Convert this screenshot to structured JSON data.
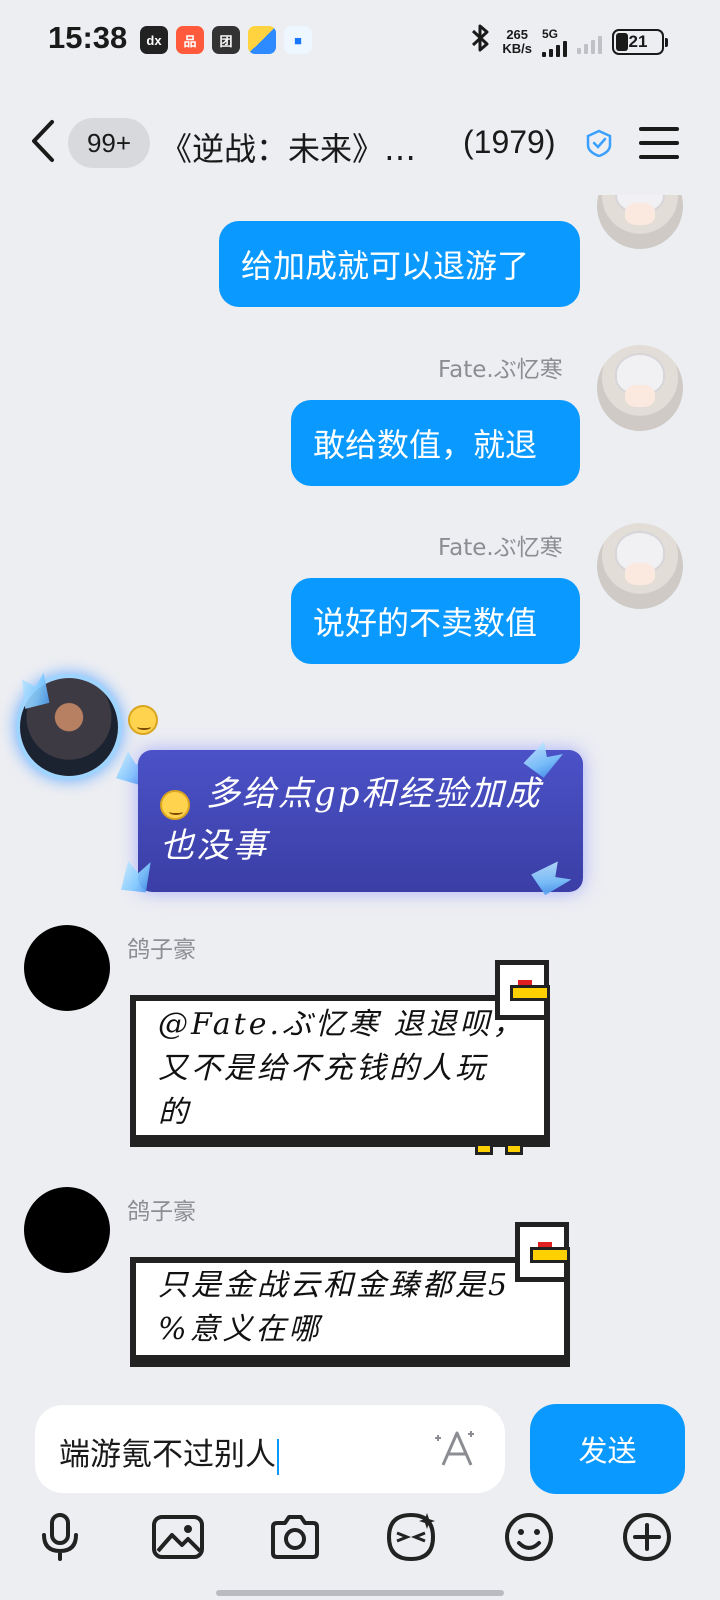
{
  "status_bar": {
    "time": "15:38",
    "apps": [
      "dx",
      "品",
      "团",
      "",
      "■"
    ],
    "speed_value": "265",
    "speed_unit": "KB/s",
    "network": "5G",
    "battery": "21"
  },
  "header": {
    "badge": "99+",
    "title": "《逆战：未来》…",
    "member_count": "(1979)"
  },
  "messages": [
    {
      "type": "self",
      "text": "给加成就可以退游了"
    },
    {
      "type": "self",
      "sender": "Fate.ぶ忆寒",
      "text": "敢给数值，就退"
    },
    {
      "type": "self",
      "sender": "Fate.ぶ忆寒",
      "text": "说好的不卖数值"
    },
    {
      "type": "other",
      "text": "多给点gp和经验加成也没事"
    },
    {
      "type": "other",
      "sender": "鸽子豪",
      "text_line1": "@Fate.ぶ忆寒 退退呗，",
      "text_line2": "又不是给不充钱的人玩",
      "text_line3": "的"
    },
    {
      "type": "other",
      "sender": "鸽子豪",
      "text_line1": "只是金战云和金臻都是5",
      "text_line2": "%意义在哪"
    }
  ],
  "input": {
    "value": "端游氪不过别人",
    "send_label": "发送"
  },
  "toolbar": {
    "icons": [
      "microphone-icon",
      "image-icon",
      "camera-icon",
      "sticker-icon",
      "emoji-icon",
      "plus-icon"
    ]
  },
  "colors": {
    "accent": "#0a99ff",
    "background": "#edeef2"
  }
}
